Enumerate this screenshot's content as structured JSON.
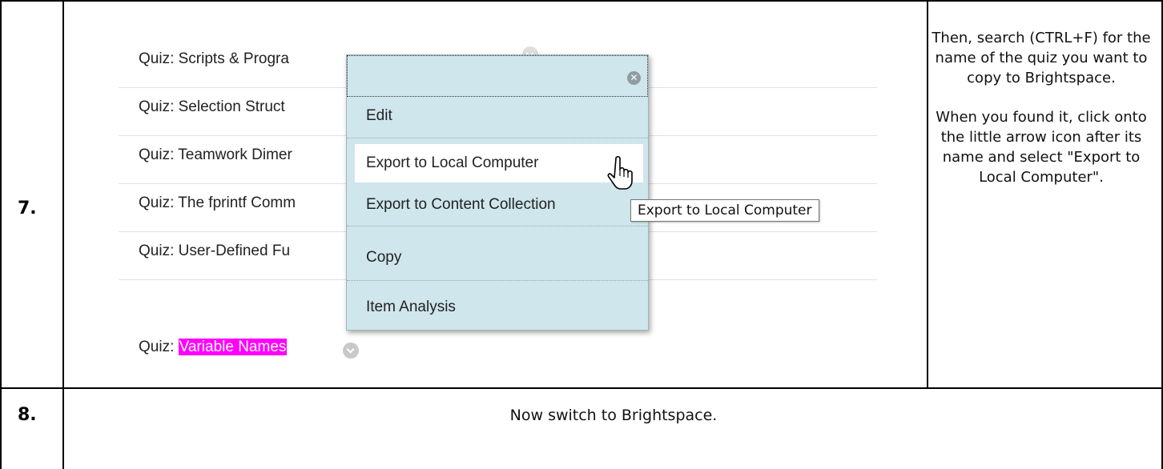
{
  "steps": [
    {
      "number": "7.",
      "instructions": [
        "Then, search (CTRL+F) for the name of the quiz you want to copy to Brightspace.",
        "When you found it, click onto the little arrow icon after its name and select \"Export to Local Computer\"."
      ]
    },
    {
      "number": "8.",
      "text": "Now switch to Brightspace."
    }
  ],
  "quizzes": [
    {
      "prefix": "Quiz: ",
      "name": "Scripts & Progra"
    },
    {
      "prefix": "Quiz: ",
      "name": "Selection Struct"
    },
    {
      "prefix": "Quiz: ",
      "name": "Teamwork Dimer"
    },
    {
      "prefix": "Quiz: ",
      "name": "The fprintf Comm"
    },
    {
      "prefix": "Quiz: ",
      "name": "User-Defined Fu"
    },
    {
      "prefix": "Quiz: ",
      "name": "Variable Names"
    }
  ],
  "menu": {
    "items": [
      "Edit",
      "Export to Local Computer",
      "Export to Content Collection",
      "Copy",
      "Item Analysis"
    ],
    "hovered": "Export to Local Computer"
  },
  "tooltip": "Export to Local Computer",
  "icons": {
    "close": "close-circle-icon",
    "arrow": "chevron-down-icon",
    "cursor": "hand-pointer-icon"
  },
  "colors": {
    "highlight": "#ff00ff",
    "menu_bg": "#cfe6ec"
  }
}
